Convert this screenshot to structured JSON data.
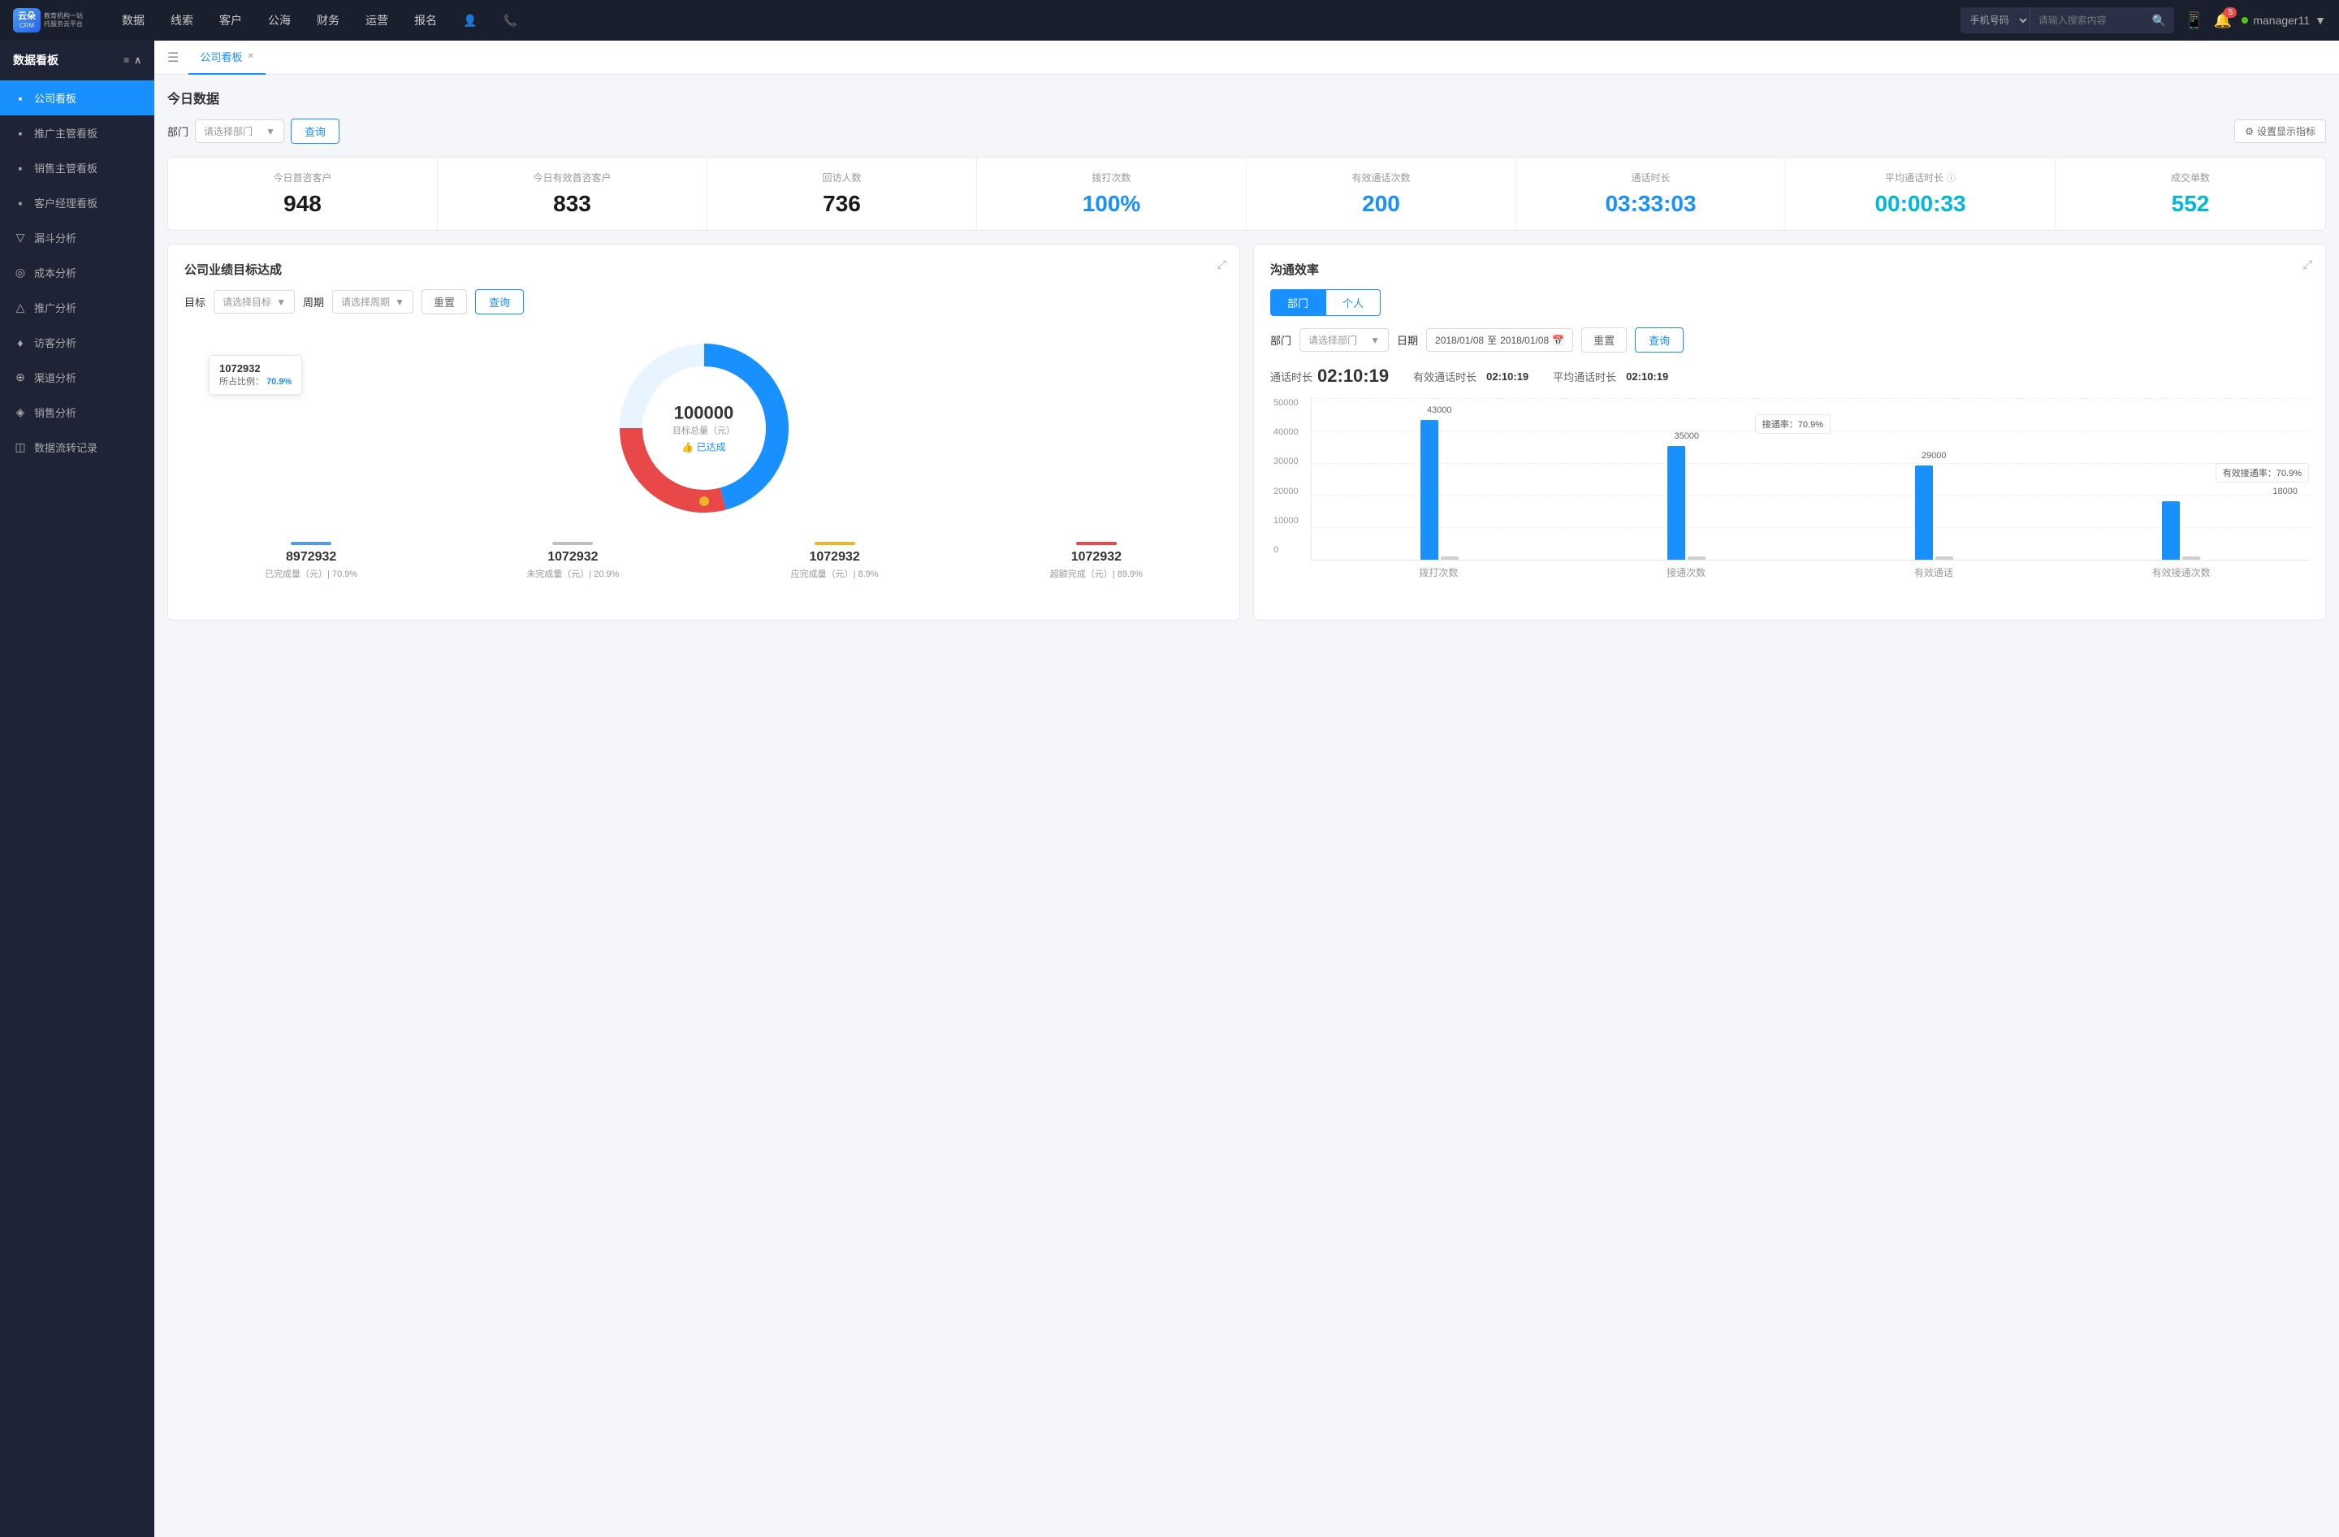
{
  "app": {
    "logo_text1": "云朵CRM",
    "logo_text2": "教育机构一站\n托服务云平台"
  },
  "top_nav": {
    "items": [
      "数据",
      "线索",
      "客户",
      "公海",
      "财务",
      "运营",
      "报名"
    ],
    "search_placeholder": "请输入搜索内容",
    "search_select": "手机号码",
    "notification_count": "5",
    "username": "manager11"
  },
  "sidebar": {
    "section_title": "数据看板",
    "items": [
      {
        "label": "公司看板",
        "icon": "▪",
        "active": true
      },
      {
        "label": "推广主管看板",
        "icon": "▪",
        "active": false
      },
      {
        "label": "销售主管看板",
        "icon": "▪",
        "active": false
      },
      {
        "label": "客户经理看板",
        "icon": "▪",
        "active": false
      },
      {
        "label": "漏斗分析",
        "icon": "▽",
        "active": false
      },
      {
        "label": "成本分析",
        "icon": "◎",
        "active": false
      },
      {
        "label": "推广分析",
        "icon": "△",
        "active": false
      },
      {
        "label": "访客分析",
        "icon": "♦",
        "active": false
      },
      {
        "label": "渠道分析",
        "icon": "⊕",
        "active": false
      },
      {
        "label": "销售分析",
        "icon": "◈",
        "active": false
      },
      {
        "label": "数据流转记录",
        "icon": "◫",
        "active": false
      }
    ]
  },
  "tab_bar": {
    "tab_label": "公司看板"
  },
  "today_data": {
    "section_title": "今日数据",
    "filter": {
      "label": "部门",
      "select_placeholder": "请选择部门",
      "query_btn": "查询",
      "settings_btn": "设置显示指标"
    },
    "stats": [
      {
        "label": "今日首咨客户",
        "value": "948",
        "color": "black"
      },
      {
        "label": "今日有效首咨客户",
        "value": "833",
        "color": "black"
      },
      {
        "label": "回访人数",
        "value": "736",
        "color": "black"
      },
      {
        "label": "拨打次数",
        "value": "100%",
        "color": "blue"
      },
      {
        "label": "有效通话次数",
        "value": "200",
        "color": "blue"
      },
      {
        "label": "通话时长",
        "value": "03:33:03",
        "color": "blue"
      },
      {
        "label": "平均通话时长",
        "value": "00:00:33",
        "color": "cyan"
      },
      {
        "label": "成交单数",
        "value": "552",
        "color": "cyan"
      }
    ]
  },
  "target_panel": {
    "title": "公司业绩目标达成",
    "target_label": "目标",
    "target_select": "请选择目标",
    "period_label": "周期",
    "period_select": "请选择周期",
    "reset_btn": "重置",
    "query_btn": "查询",
    "tooltip": {
      "number": "1072932",
      "ratio_label": "所占比例：",
      "ratio": "70.9%"
    },
    "donut": {
      "center_num": "100000",
      "center_sub": "目标总量（元）",
      "achieved_label": "👍 已达成"
    },
    "stats": [
      {
        "label": "已完成量（元）| 70.9%",
        "value": "8972932",
        "color": "#4e9af1",
        "bar_color": "#4e9af1"
      },
      {
        "label": "未完成量（元）| 20.9%",
        "value": "1072932",
        "color": "#c0c0c0",
        "bar_color": "#c0c0c0"
      },
      {
        "label": "应完成量（元）| 8.9%",
        "value": "1072932",
        "color": "#f0b429",
        "bar_color": "#f0b429"
      },
      {
        "label": "超额完成（元）| 89.9%",
        "value": "1072932",
        "color": "#e84848",
        "bar_color": "#e84848"
      }
    ]
  },
  "comm_panel": {
    "title": "沟通效率",
    "tabs": [
      "部门",
      "个人"
    ],
    "active_tab": 0,
    "dept_label": "部门",
    "dept_select": "请选择部门",
    "date_label": "日期",
    "date_from": "2018/01/08",
    "date_to": "2018/01/08",
    "reset_btn": "重置",
    "query_btn": "查询",
    "stats": {
      "call_duration_label": "通话时长",
      "call_duration": "02:10:19",
      "effective_label": "有效通话时长",
      "effective_val": "02:10:19",
      "avg_label": "平均通话时长",
      "avg_val": "02:10:19"
    },
    "chart": {
      "y_labels": [
        "50000",
        "40000",
        "30000",
        "20000",
        "10000",
        "0"
      ],
      "x_labels": [
        "拨打次数",
        "接通次数",
        "有效通话",
        "有效接通次数"
      ],
      "groups": [
        {
          "label": "拨打次数",
          "bars": [
            {
              "value": 43000,
              "label": "43000",
              "color": "#1890ff",
              "height": 172
            },
            {
              "value": 0,
              "label": "",
              "color": "#d0d0d0",
              "height": 4
            }
          ],
          "annotation": null
        },
        {
          "label": "接通次数",
          "bars": [
            {
              "value": 35000,
              "label": "35000",
              "color": "#1890ff",
              "height": 140
            },
            {
              "value": 0,
              "label": "",
              "color": "#d0d0d0",
              "height": 4
            }
          ],
          "annotation": "接通率：70.9%"
        },
        {
          "label": "有效通话",
          "bars": [
            {
              "value": 29000,
              "label": "29000",
              "color": "#1890ff",
              "height": 116
            },
            {
              "value": 0,
              "label": "",
              "color": "#d0d0d0",
              "height": 4
            }
          ],
          "annotation": null
        },
        {
          "label": "有效接通次数",
          "bars": [
            {
              "value": 18000,
              "label": "18000",
              "color": "#1890ff",
              "height": 72
            },
            {
              "value": 0,
              "label": "",
              "color": "#d0d0d0",
              "height": 4
            }
          ],
          "annotation": "有效接通率：70.9%"
        }
      ]
    }
  }
}
